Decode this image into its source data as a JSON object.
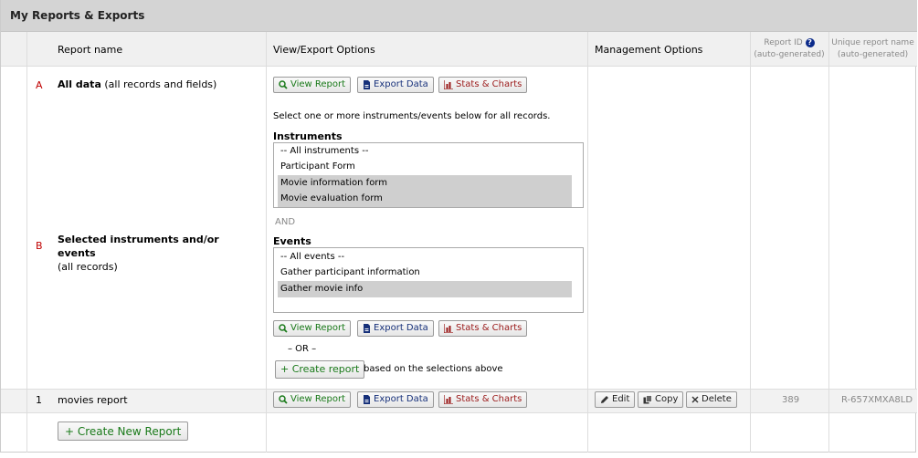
{
  "panel_title": "My Reports & Exports",
  "columns": {
    "report_name": "Report name",
    "view_export": "View/Export Options",
    "management": "Management Options",
    "report_id": "Report ID",
    "report_id_sub": "(auto-generated)",
    "unique_name": "Unique report name",
    "unique_name_sub": "(auto-generated)"
  },
  "buttons": {
    "view_report": "View Report",
    "export_data": "Export Data",
    "stats_charts": "Stats & Charts",
    "create_report": "+ Create report",
    "edit": "Edit",
    "copy": "Copy",
    "delete": "Delete",
    "create_new_report": "+ Create New Report"
  },
  "row_a": {
    "letter": "A",
    "name_bold": "All data",
    "name_rest": "(all records and fields)"
  },
  "row_b": {
    "letter": "B",
    "name_bold": "Selected instruments and/or events",
    "name_rest": "(all records)",
    "instructions": "Select one or more instruments/events below for all records.",
    "instruments_label": "Instruments",
    "instruments": [
      {
        "label": "-- All instruments --",
        "selected": false
      },
      {
        "label": "Participant Form",
        "selected": false
      },
      {
        "label": "Movie information form",
        "selected": true
      },
      {
        "label": "Movie evaluation form",
        "selected": true
      }
    ],
    "and_text": "AND",
    "events_label": "Events",
    "events": [
      {
        "label": "-- All events --",
        "selected": false
      },
      {
        "label": "Gather participant information",
        "selected": false
      },
      {
        "label": "Gather movie info",
        "selected": true
      }
    ],
    "or_text": "– OR –",
    "based_on": "based on the selections above"
  },
  "row_1": {
    "number": "1",
    "name": "movies report",
    "report_id": "389",
    "unique_name": "R-657XMXA8LD"
  },
  "colors": {
    "header_bg": "#d4d4d4",
    "letter": "#c00000",
    "green": "#1a7a1a",
    "blue": "#16307a",
    "red": "#9b1a1a",
    "help_icon": "#0b2a8a"
  },
  "icons": [
    "search-icon",
    "file-icon",
    "chart-icon",
    "pencil-icon",
    "copy-icon",
    "x-icon",
    "help-icon"
  ]
}
